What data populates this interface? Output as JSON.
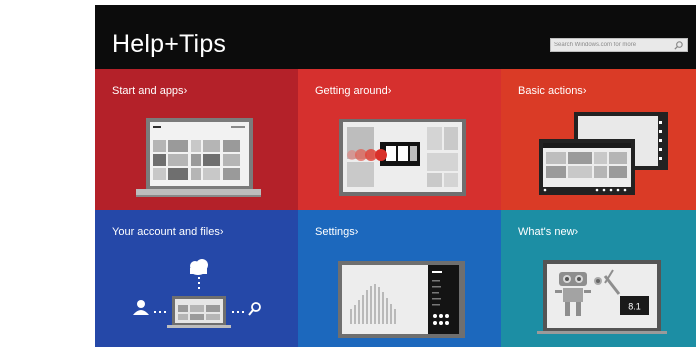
{
  "app": {
    "title": "Help+Tips"
  },
  "search": {
    "placeholder": "Search Windows.com for more",
    "icon": "search-icon"
  },
  "tiles": [
    {
      "label": "Start and apps",
      "chevron": "›",
      "color": "#b42129"
    },
    {
      "label": "Getting around",
      "chevron": "›",
      "color": "#d6302e"
    },
    {
      "label": "Basic actions",
      "chevron": "›",
      "color": "#da3b26"
    },
    {
      "label": "Your account and files",
      "chevron": "›",
      "color": "#2548a8"
    },
    {
      "label": "Settings",
      "chevron": "›",
      "color": "#1c68bd"
    },
    {
      "label": "What's new",
      "chevron": "›",
      "color": "#1c8ea4"
    }
  ],
  "whats_new": {
    "badge": "8.1"
  }
}
